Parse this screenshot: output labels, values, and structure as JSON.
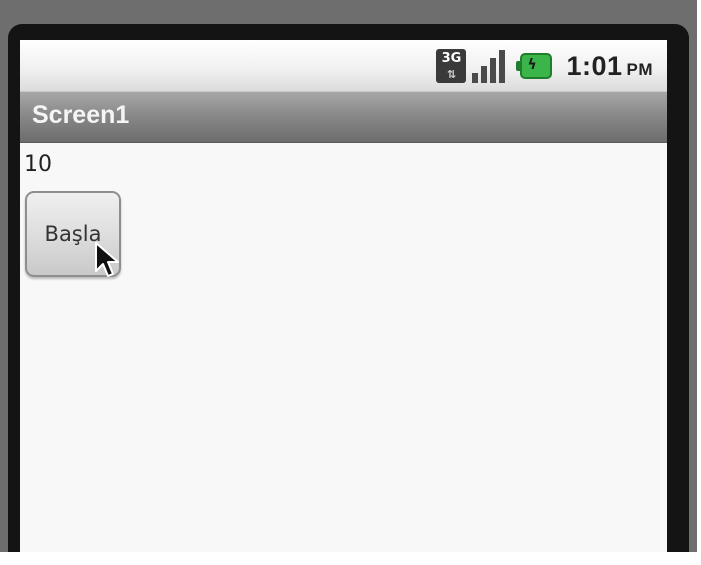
{
  "status_bar": {
    "network": "3G",
    "clock": "1:01",
    "ampm": "PM"
  },
  "title_bar": {
    "title": "Screen1"
  },
  "content": {
    "label_value": "10",
    "start_button_label": "Başla"
  },
  "icons": [
    "3g-network-icon",
    "signal-strength-icon",
    "battery-charging-icon",
    "mouse-cursor-icon"
  ]
}
